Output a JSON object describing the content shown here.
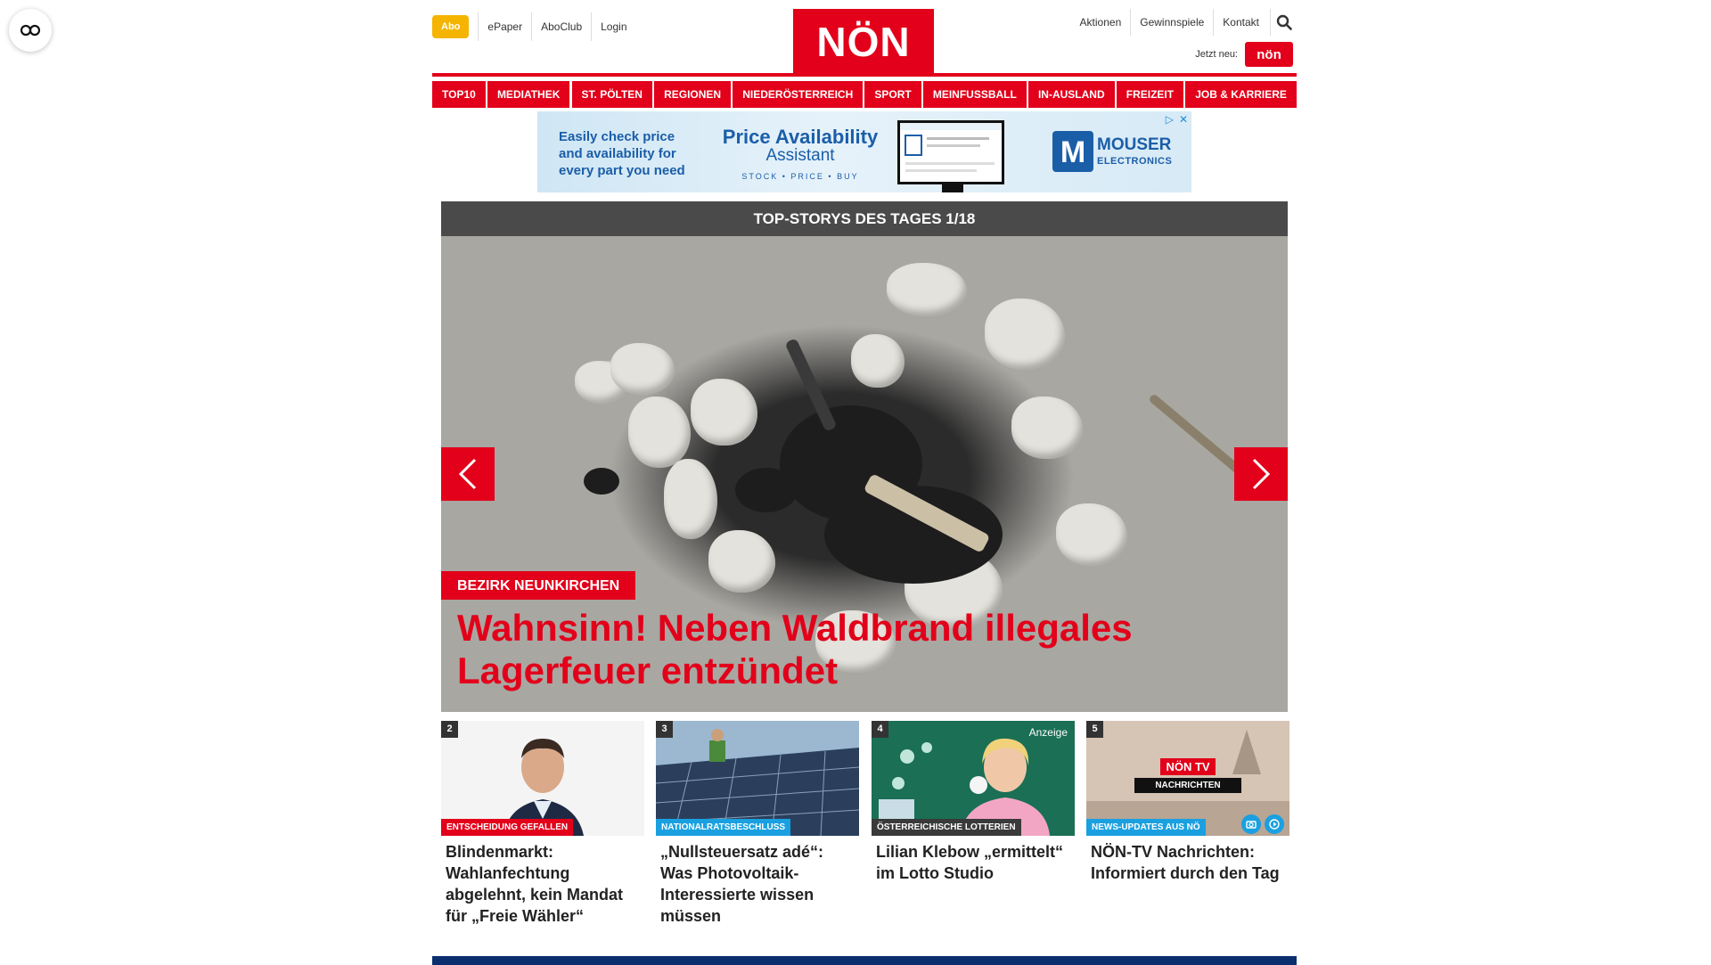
{
  "topnav": {
    "abo": "Abo",
    "left_links": [
      "ePaper",
      "AboClub",
      "Login"
    ],
    "right_links": [
      "Aktionen",
      "Gewinnspiele",
      "Kontakt"
    ],
    "jetzt_label": "Jetzt neu:",
    "mini_logo": "nön"
  },
  "logo": "NÖN",
  "mainnav": [
    "TOP10",
    "MEDIATHEK",
    "ST. PÖLTEN",
    "REGIONEN",
    "NIEDERÖSTERREICH",
    "SPORT",
    "MEINFUSSBALL",
    "IN-AUSLAND",
    "FREIZEIT",
    "JOB & KARRIERE"
  ],
  "ad": {
    "text": "Easily check price and availability for every part you need",
    "pa_title": "Price Availability",
    "pa_sub": "Assistant",
    "pa_tag": "STOCK • PRICE • BUY",
    "mouser": "MOUSER",
    "mouser_sub": "ELECTRONICS",
    "mouser_m": "M",
    "choices": [
      "▷",
      "✕"
    ]
  },
  "hero": {
    "header": "TOP-STORYS DES TAGES 1/18",
    "tag": "BEZIRK NEUNKIRCHEN",
    "title": "Wahnsinn! Neben Waldbrand illegales Lagerfeuer entzündet"
  },
  "teasers": [
    {
      "num": "2",
      "tag": "ENTSCHEIDUNG GEFALLEN",
      "tag_color": "#e2001a",
      "title": "Blindenmarkt: Wahlanfechtung abgelehnt, kein Mandat für „Freie Wähler“"
    },
    {
      "num": "3",
      "tag": "NATIONALRATSBESCHLUSS",
      "tag_color": "#1aa0e0",
      "title": "„Nullsteuersatz adé“: Was Photovoltaik-Interessierte wissen müssen"
    },
    {
      "num": "4",
      "tag": "ÖSTERREICHISCHE LOTTERIEN",
      "tag_color": "#3a3a3a",
      "title": "Lilian Klebow „ermittelt“ im Lotto Studio",
      "badge": "Anzeige"
    },
    {
      "num": "5",
      "tag": "NEWS-UPDATES AUS NÖ",
      "tag_color": "#1aa0e0",
      "title": "NÖN-TV Nachrichten: Informiert durch den Tag",
      "tv_logo": "NÖN TV",
      "tv_label": "NACHRICHTEN"
    }
  ],
  "colors": {
    "brand": "#e2001a",
    "abo": "#f5b400",
    "blue_tag": "#1aa0e0",
    "footer": "#0b2f6e"
  }
}
